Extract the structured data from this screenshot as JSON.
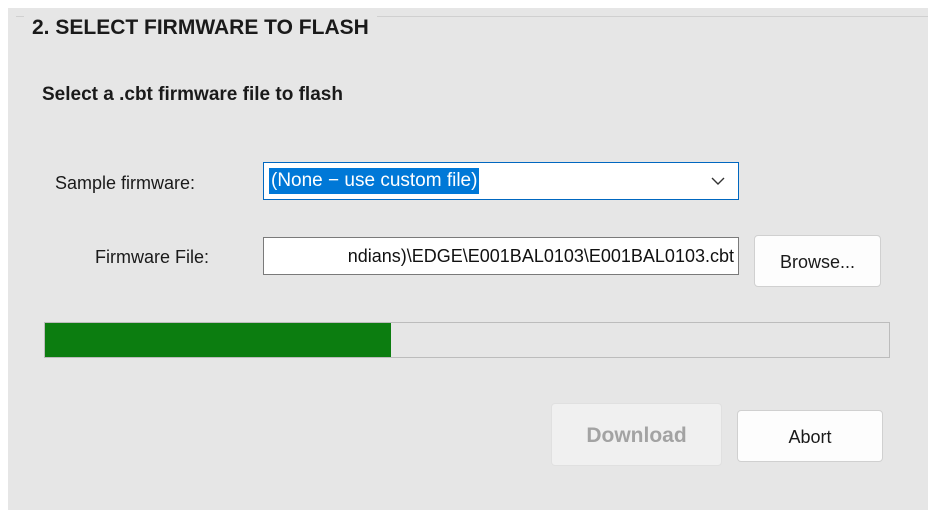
{
  "group": {
    "title": "2. SELECT FIRMWARE TO FLASH"
  },
  "subheading": "Select a .cbt firmware file to flash",
  "sample_firmware": {
    "label": "Sample firmware:",
    "selected": "(None − use custom file)"
  },
  "firmware_file": {
    "label": "Firmware File:",
    "value": "ndians)\\EDGE\\E001BAL0103\\E001BAL0103.cbt"
  },
  "buttons": {
    "browse": "Browse...",
    "download": "Download",
    "abort": "Abort"
  },
  "progress": {
    "fraction": 0.41,
    "fill_color": "#0c7d10"
  },
  "colors": {
    "accent": "#0078d7",
    "panel_bg": "#e6e6e6",
    "disabled_text": "#a3a3a3"
  }
}
